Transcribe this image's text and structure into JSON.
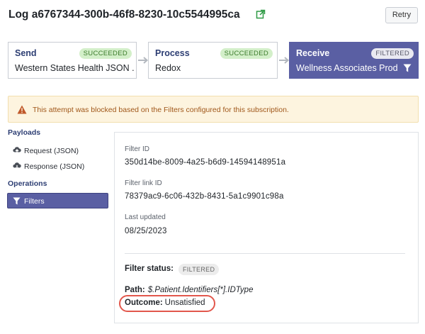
{
  "header": {
    "log_title": "Log a6767344-300b-46f8-8230-10c5544995ca",
    "retry_label": "Retry"
  },
  "steps": [
    {
      "name": "Send",
      "status": "SUCCEEDED",
      "sub": "Western States Health JSON ..."
    },
    {
      "name": "Process",
      "status": "SUCCEEDED",
      "sub": "Redox"
    },
    {
      "name": "Receive",
      "status": "FILTERED",
      "sub": "Wellness Associates Prod"
    }
  ],
  "warning": {
    "text": "This attempt was blocked based on the Filters configured for this subscription."
  },
  "sidebar": {
    "payloads_heading": "Payloads",
    "request_label": "Request (JSON)",
    "response_label": "Response (JSON)",
    "operations_heading": "Operations",
    "filters_label": "Filters"
  },
  "filter": {
    "filter_id_label": "Filter ID",
    "filter_id": "350d14be-8009-4a25-b6d9-14594148951a",
    "filter_link_id_label": "Filter link ID",
    "filter_link_id": "78379ac9-6c06-432b-8431-5a1c9901c98a",
    "last_updated_label": "Last updated",
    "last_updated": "08/25/2023",
    "status_label": "Filter status:",
    "status_value": "FILTERED",
    "path_label": "Path:",
    "path_value": "$.Patient.Identifiers[*].IDType",
    "outcome_label": "Outcome:",
    "outcome_value": "Unsatisfied"
  },
  "colors": {
    "accent": "#5a5fa3",
    "success_bg": "#d3efc9",
    "warning_bg": "#fdf4df",
    "highlight_ring": "#e2574c"
  }
}
